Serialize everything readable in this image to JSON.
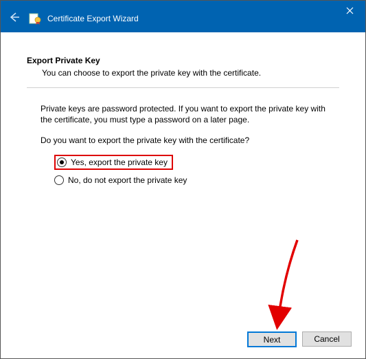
{
  "titlebar": {
    "text": "Certificate Export Wizard"
  },
  "heading": "Export Private Key",
  "heading_desc": "You can choose to export the private key with the certificate.",
  "body": "Private keys are password protected. If you want to export the private key with the certificate, you must type a password on a later page.",
  "prompt": "Do you want to export the private key with the certificate?",
  "options": {
    "yes": "Yes, export the private key",
    "no": "No, do not export the private key"
  },
  "buttons": {
    "next": "Next",
    "cancel": "Cancel"
  }
}
